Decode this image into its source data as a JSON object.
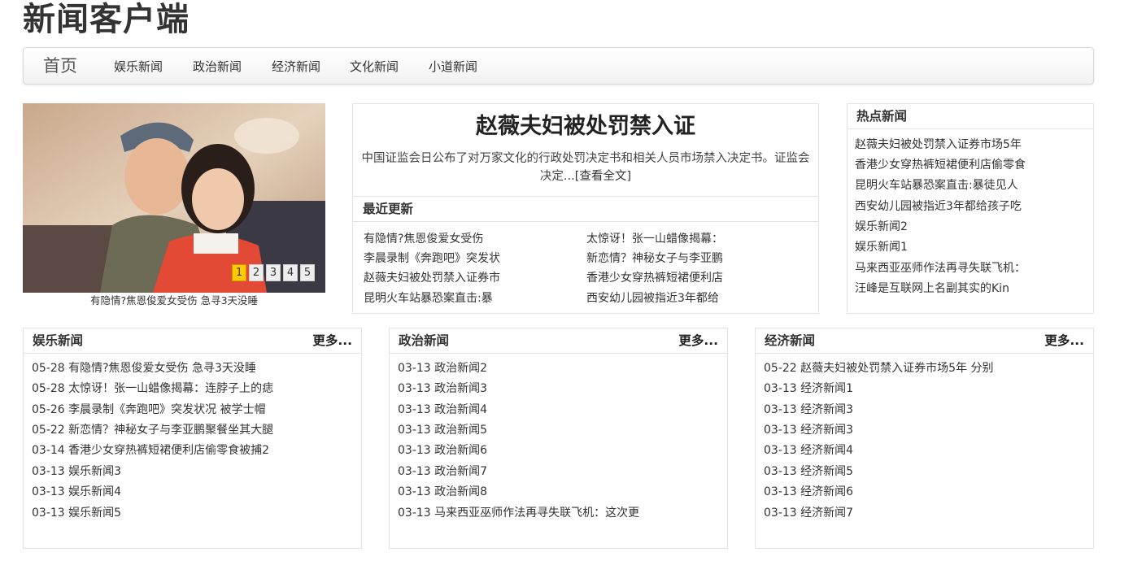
{
  "site": {
    "title": "新闻客户端"
  },
  "nav": {
    "brand": "首页",
    "items": [
      "娱乐新闻",
      "政治新闻",
      "经济新闻",
      "文化新闻",
      "小道新闻"
    ]
  },
  "slider": {
    "caption": "有隐情?焦恩俊爱女受伤 急寻3天没睡",
    "pages": [
      "1",
      "2",
      "3",
      "4",
      "5"
    ],
    "active_page": 1
  },
  "feature": {
    "headline": "赵薇夫妇被处罚禁入证",
    "summary": "中国证监会日公布了对万家文化的行政处罚决定书和相关人员市场禁入决定书。证监会决定...",
    "more_label": "[查看全文]"
  },
  "recent": {
    "title": "最近更新",
    "left": [
      "有隐情?焦恩俊爱女受伤",
      "李晨录制《奔跑吧》突发状",
      "赵薇夫妇被处罚禁入证券市",
      "昆明火车站暴恐案直击:暴"
    ],
    "right": [
      "太惊讶！张一山蜡像揭幕：",
      "新恋情？神秘女子与李亚鹏",
      "香港少女穿热裤短裙便利店",
      "西安幼儿园被指近3年都给"
    ]
  },
  "hot": {
    "title": "热点新闻",
    "items": [
      "赵薇夫妇被处罚禁入证券市场5年",
      "香港少女穿热裤短裙便利店偷零食",
      "昆明火车站暴恐案直击:暴徒见人",
      "西安幼儿园被指近3年都给孩子吃",
      "娱乐新闻2",
      "娱乐新闻1",
      "马来西亚巫师作法再寻失联飞机：",
      "汪峰是互联网上名副其实的Kin"
    ]
  },
  "categories": [
    {
      "title": "娱乐新闻",
      "more": "更多...",
      "items": [
        "05-28 有隐情?焦恩俊爱女受伤 急寻3天没睡",
        "05-28 太惊讶！张一山蜡像揭幕：连脖子上的痣",
        "05-26 李晨录制《奔跑吧》突发状况 被学士帽",
        "05-22 新恋情？神秘女子与李亚鹏聚餐坐其大腿",
        "03-14 香港少女穿热裤短裙便利店偷零食被捕2",
        "03-13 娱乐新闻3",
        "03-13 娱乐新闻4",
        "03-13 娱乐新闻5"
      ]
    },
    {
      "title": "政治新闻",
      "more": "更多...",
      "items": [
        "03-13 政治新闻2",
        "03-13 政治新闻3",
        "03-13 政治新闻4",
        "03-13 政治新闻5",
        "03-13 政治新闻6",
        "03-13 政治新闻7",
        "03-13 政治新闻8",
        "03-13 马来西亚巫师作法再寻失联飞机：这次更"
      ]
    },
    {
      "title": "经济新闻",
      "more": "更多...",
      "items": [
        "05-22 赵薇夫妇被处罚禁入证券市场5年 分别",
        "03-13 经济新闻1",
        "03-13 经济新闻3",
        "03-13 经济新闻3",
        "03-13 经济新闻4",
        "03-13 经济新闻5",
        "03-13 经济新闻6",
        "03-13 经济新闻7"
      ]
    }
  ],
  "colors": {
    "accent": "#ffcc00",
    "border": "#e3e3e3",
    "text": "#333333"
  }
}
